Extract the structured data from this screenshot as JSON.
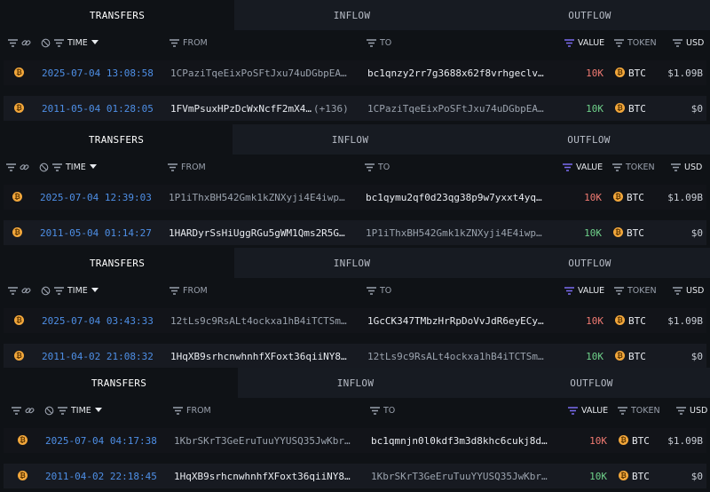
{
  "tabs": [
    "TRANSFERS",
    "INFLOW",
    "OUTFLOW"
  ],
  "headers": {
    "time": "TIME",
    "from": "FROM",
    "to": "TO",
    "value": "VALUE",
    "token": "TOKEN",
    "usd": "USD"
  },
  "colors": {
    "outflow": "#f07a72",
    "inflow": "#6fd18a",
    "time": "#4e8fe6",
    "btc": "#f2a73b"
  },
  "icons": {
    "coin": "bitcoin-icon",
    "filter": "filter-icon",
    "link": "link-icon",
    "hide": "hide-icon",
    "sort": "sort-down-icon"
  },
  "panels": [
    {
      "rows": [
        {
          "time": "2025-07-04 13:08:58",
          "from": "1CPaziTqeEixPoSFtJxu74uDGbpEA…",
          "from_count": "",
          "to": "bc1qnzy2rr7g3688x62f8vrhgeclv…",
          "value": "10K",
          "token": "BTC",
          "usd": "$1.09B",
          "direction": "out"
        },
        {
          "time": "2011-05-04 01:28:05",
          "from": "1FVmPsuxHPzDcWxNcfF2mX4…",
          "from_count": "(+136)",
          "to": "1CPaziTqeEixPoSFtJxu74uDGbpEA…",
          "value": "10K",
          "token": "BTC",
          "usd": "$0",
          "direction": "in"
        }
      ]
    },
    {
      "rows": [
        {
          "time": "2025-07-04 12:39:03",
          "from": "1P1iThxBH542Gmk1kZNXyji4E4iwp…",
          "from_count": "",
          "to": "bc1qymu2qf0d23qg38p9w7yxxt4yq…",
          "value": "10K",
          "token": "BTC",
          "usd": "$1.09B",
          "direction": "out"
        },
        {
          "time": "2011-05-04 01:14:27",
          "from": "1HARDyrSsHiUggRGu5gWM1Qms2R5G…",
          "from_count": "",
          "to": "1P1iThxBH542Gmk1kZNXyji4E4iwp…",
          "value": "10K",
          "token": "BTC",
          "usd": "$0",
          "direction": "in"
        }
      ]
    },
    {
      "rows": [
        {
          "time": "2025-07-04 03:43:33",
          "from": "12tLs9c9RsALt4ockxa1hB4iTCTSm…",
          "from_count": "",
          "to": "1GcCK347TMbzHrRpDoVvJdR6eyECy…",
          "value": "10K",
          "token": "BTC",
          "usd": "$1.09B",
          "direction": "out"
        },
        {
          "time": "2011-04-02 21:08:32",
          "from": "1HqXB9srhcnwhnhfXFoxt36qiiNY8…",
          "from_count": "",
          "to": "12tLs9c9RsALt4ockxa1hB4iTCTSm…",
          "value": "10K",
          "token": "BTC",
          "usd": "$0",
          "direction": "in"
        }
      ]
    },
    {
      "rows": [
        {
          "time": "2025-07-04 04:17:38",
          "from": "1KbrSKrT3GeEruTuuYYUSQ35JwKbr…",
          "from_count": "",
          "to": "bc1qmnjn0l0kdf3m3d8khc6cukj8d…",
          "value": "10K",
          "token": "BTC",
          "usd": "$1.09B",
          "direction": "out"
        },
        {
          "time": "2011-04-02 22:18:45",
          "from": "1HqXB9srhcnwhnhfXFoxt36qiiNY8…",
          "from_count": "",
          "to": "1KbrSKrT3GeEruTuuYYUSQ35JwKbr…",
          "value": "10K",
          "token": "BTC",
          "usd": "$0",
          "direction": "in"
        }
      ]
    }
  ]
}
